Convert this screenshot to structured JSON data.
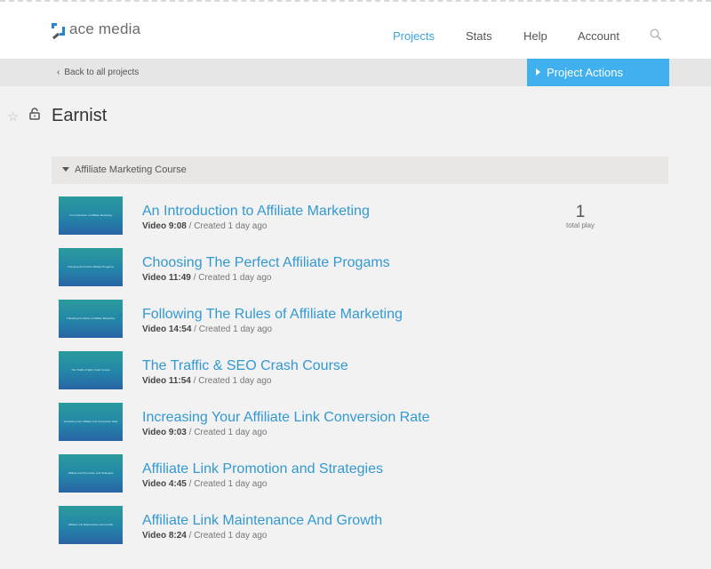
{
  "brand": {
    "name": "ace media",
    "accent": "#3aa3dd",
    "button_color": "#40b0ef"
  },
  "nav": {
    "items": [
      "Projects",
      "Stats",
      "Help",
      "Account"
    ],
    "active": "Projects",
    "search_icon": "search-icon"
  },
  "subbar": {
    "back_label": "Back to all projects",
    "actions_label": "Project Actions"
  },
  "project": {
    "title": "Earnist",
    "star_icon": "star-icon",
    "lock_icon": "lock-icon"
  },
  "section": {
    "title": "Affiliate Marketing Course",
    "videos": [
      {
        "title": "An Introduction to Affiliate Marketing",
        "type": "Video",
        "duration": "9:08",
        "created": "Created 1 day ago",
        "thumb_caption": "An Introduction to Affiliate Marketing",
        "plays": "1",
        "plays_label": "total play"
      },
      {
        "title": "Choosing The Perfect Affiliate Progams",
        "type": "Video",
        "duration": "11:49",
        "created": "Created 1 day ago",
        "thumb_caption": "Choosing the Perfect Affiliate Programs"
      },
      {
        "title": "Following The Rules of Affiliate Marketing",
        "type": "Video",
        "duration": "14:54",
        "created": "Created 1 day ago",
        "thumb_caption": "Following the Rules of Affiliate Marketing"
      },
      {
        "title": "The Traffic & SEO Crash Course",
        "type": "Video",
        "duration": "11:54",
        "created": "Created 1 day ago",
        "thumb_caption": "The Traffic & SEO Crash Course"
      },
      {
        "title": "Increasing Your Affiliate Link Conversion Rate",
        "type": "Video",
        "duration": "9:03",
        "created": "Created 1 day ago",
        "thumb_caption": "Increasing Your Affiliate Link Conversion Rate"
      },
      {
        "title": "Affiliate Link Promotion and Strategies",
        "type": "Video",
        "duration": "4:45",
        "created": "Created 1 day ago",
        "thumb_caption": "Affiliate Link Promotion and Strategies"
      },
      {
        "title": "Affiliate Link Maintenance And Growth",
        "type": "Video",
        "duration": "8:24",
        "created": "Created 1 day ago",
        "thumb_caption": "Affiliate Link Maintenance and Growth"
      }
    ]
  }
}
